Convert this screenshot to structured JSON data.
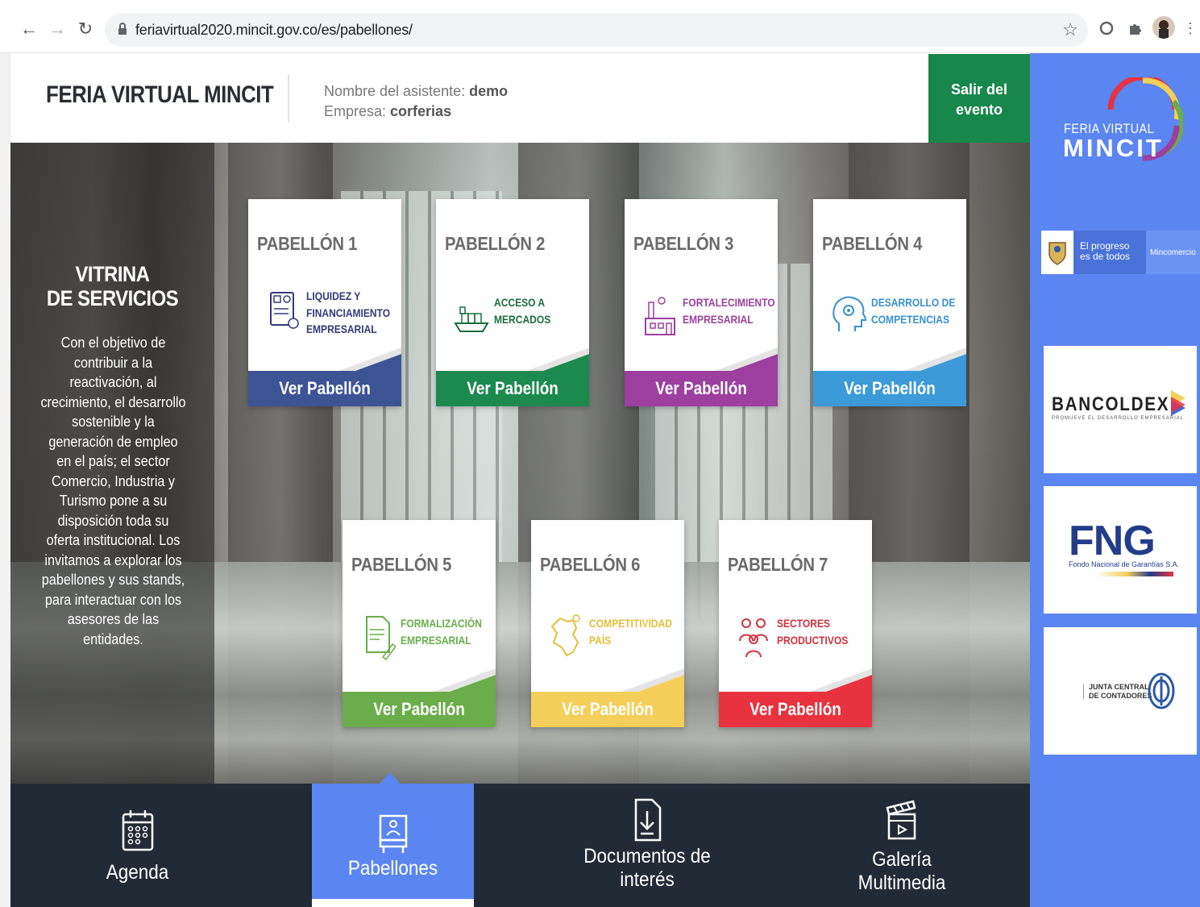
{
  "browser": {
    "url": "feriavirtual2020.mincit.gov.co/es/pabellones/",
    "back_icon": "←",
    "forward_icon": "→",
    "reload_icon": "↻",
    "star_icon": "☆",
    "menu_icon": "⋮"
  },
  "header": {
    "brand": "FERIA VIRTUAL MINCIT",
    "attendee_label": "Nombre del asistente: ",
    "attendee_value": "demo",
    "company_label": "Empresa: ",
    "company_value": "corferias",
    "exit_label_1": "Salir del",
    "exit_label_2": "evento"
  },
  "sidebar": {
    "logo_line1": "FERIA VIRTUAL",
    "logo_line2": "MINCIT",
    "gov_progress": [
      "El progreso",
      "es de todos"
    ],
    "gov_ministry": "Mincomercio",
    "partners": [
      {
        "name": "BANCOLDEX",
        "tagline": "PROMUEVE EL DESARROLLO EMPRESARIAL"
      },
      {
        "name": "FNG",
        "tagline": "Fondo Nacional de Garantías S.A."
      },
      {
        "name": "JUNTA CENTRAL DE CONTADORES",
        "line1": "JUNTA CENTRAL",
        "line2": "DE CONTADORES"
      }
    ]
  },
  "vitrina": {
    "title_1": "VITRINA",
    "title_2": "DE SERVICIOS",
    "body": "Con el objetivo de contribuir a la reactivación, al crecimiento, el desarrollo sostenible y la generación de empleo en el país; el sector Comercio, Industria y Turismo pone a su disposición toda su oferta institucional. Los invitamos a explorar los pabellones y sus stands, para interactuar con los asesores de las entidades."
  },
  "pavilions": [
    {
      "title": "PABELLÓN 1",
      "subtitle": [
        "LIQUIDEZ Y",
        "FINANCIAMIENTO",
        "EMPRESARIAL"
      ],
      "button": "Ver Pabellón",
      "color": "#3d5494",
      "text_color": "#333a7a",
      "icon": "document-money-icon"
    },
    {
      "title": "PABELLÓN 2",
      "subtitle": [
        "ACCESO A",
        "MERCADOS"
      ],
      "button": "Ver Pabellón",
      "color": "#1c8a4f",
      "text_color": "#1a6e40",
      "icon": "cargo-ship-icon"
    },
    {
      "title": "PABELLÓN 3",
      "subtitle": [
        "FORTALECIMIENTO",
        "EMPRESARIAL"
      ],
      "button": "Ver Pabellón",
      "color": "#9c3f9f",
      "text_color": "#9c3f9f",
      "icon": "factory-icon"
    },
    {
      "title": "PABELLÓN 4",
      "subtitle": [
        "DESARROLLO DE",
        "COMPETENCIAS"
      ],
      "button": "Ver Pabellón",
      "color": "#3c9ad8",
      "text_color": "#3790cf",
      "icon": "head-gear-icon"
    },
    {
      "title": "PABELLÓN 5",
      "subtitle": [
        "FORMALIZACIÓN",
        "EMPRESARIAL"
      ],
      "button": "Ver Pabellón",
      "color": "#6aad4a",
      "text_color": "#6aad4a",
      "icon": "document-pen-icon"
    },
    {
      "title": "PABELLÓN 6",
      "subtitle": [
        "COMPETITIVIDAD",
        "PAÍS"
      ],
      "button": "Ver Pabellón",
      "color": "#f4cf5a",
      "text_color": "#e8bd3a",
      "icon": "colombia-map-icon"
    },
    {
      "title": "PABELLÓN 7",
      "subtitle": [
        "SECTORES",
        "PRODUCTIVOS"
      ],
      "button": "Ver Pabellón",
      "color": "#e8323f",
      "text_color": "#d6303c",
      "icon": "people-icon"
    }
  ],
  "bottom_nav": [
    {
      "label_1": "Agenda",
      "label_2": "",
      "icon": "calendar-icon",
      "active": false
    },
    {
      "label_1": "Pabellones",
      "label_2": "",
      "icon": "pavilion-icon",
      "active": true
    },
    {
      "label_1": "Documentos de",
      "label_2": "interés",
      "icon": "document-download-icon",
      "active": false
    },
    {
      "label_1": "Galería",
      "label_2": "Multimedia",
      "icon": "clapperboard-icon",
      "active": false
    }
  ]
}
